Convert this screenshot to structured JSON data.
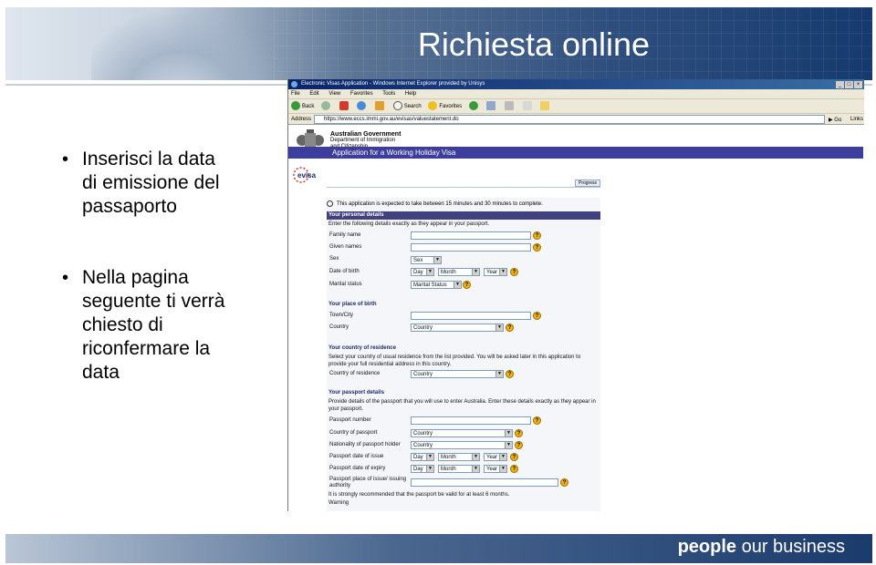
{
  "slide": {
    "title": "Richiesta online",
    "bullets": [
      {
        "dot": "•",
        "text": "Inserisci la data\ndi emissione del\npassaporto"
      },
      {
        "dot": "•",
        "text": "Nella pagina\nseguente ti verrà\nchiesto di\nriconfermare la\ndata"
      }
    ],
    "footer": {
      "part1": "people",
      "part2": " our business"
    }
  },
  "browser": {
    "window_title": "Electronic Visas Application - Windows Internet Explorer provided by Unisys",
    "menu": [
      "File",
      "Edit",
      "View",
      "Favorites",
      "Tools",
      "Help"
    ],
    "toolbar": {
      "back": "Back",
      "search": "Search",
      "favorites": "Favorites"
    },
    "address_label": "Address",
    "address_url": "https://www.eccs.immi.gov.au/evisas/valuestatement.do",
    "go_label": "Go",
    "links_label": "Links"
  },
  "page": {
    "gov_line1": "Australian Government",
    "gov_line2": "Department of Immigration",
    "gov_line3": "and Citizenship",
    "app_title": "Application for a Working Holiday Visa",
    "evisa_logo": "evisa",
    "progress_label": "Progress",
    "time_note": "This application is expected to take between 15 minutes and 30 minutes to complete.",
    "personal": {
      "heading": "Your personal details",
      "note": "Enter the following details exactly as they appear in your passport.",
      "family_name": "Family name",
      "given_names": "Given names",
      "sex": "Sex",
      "sex_value": "Sex",
      "dob": "Date of birth",
      "day": "Day",
      "month": "Month",
      "year": "Year",
      "marital": "Marital status",
      "marital_value": "Marital Status"
    },
    "birth": {
      "heading": "Your place of birth",
      "town": "Town/City",
      "country": "Country",
      "country_value": "Country"
    },
    "residence": {
      "heading": "Your country of residence",
      "note": "Select your country of usual residence from the list provided. You will be asked later in this application to provide your full residential address in this country.",
      "label": "Country of residence",
      "value": "Country"
    },
    "passport": {
      "heading": "Your passport details",
      "note": "Provide details of the passport that you will use to enter Australia. Enter these details exactly as they appear in your passport.",
      "number": "Passport number",
      "country": "Country of passport",
      "nationality": "Nationality of passport holder",
      "issue": "Passport date of issue",
      "expiry": "Passport date of expiry",
      "place": "Passport place of issue/ issuing authority",
      "country_value": "Country",
      "day": "Day",
      "month": "Month",
      "year": "Year",
      "recommend": "It is strongly recommended that the passport be valid for at least 6 months.",
      "warning": "Warning"
    }
  }
}
